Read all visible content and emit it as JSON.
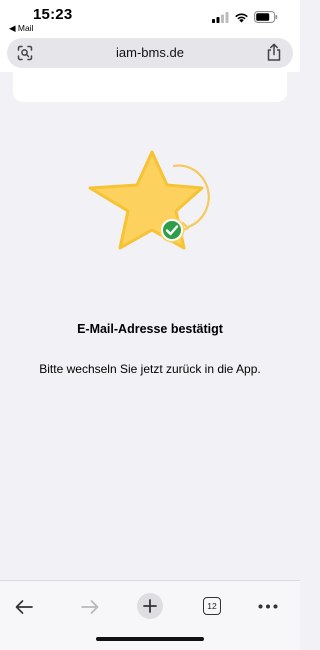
{
  "status_bar": {
    "time": "15:23",
    "back_app": "◀ Mail",
    "icons": [
      "cellular-signal-icon",
      "wifi-icon",
      "battery-icon"
    ]
  },
  "address_bar": {
    "url": "iam-bms.de",
    "left_icon": "page-tools-icon",
    "right_icon": "share-icon"
  },
  "content": {
    "heading": "E-Mail-Adresse bestätigt",
    "message": "Bitte wechseln Sie jetzt zurück in die App.",
    "illustration": "star-check-illustration"
  },
  "toolbar": {
    "tab_count": "12",
    "buttons": [
      "back-icon",
      "forward-icon",
      "plus-icon",
      "tabs-icon",
      "more-icon"
    ]
  },
  "colors": {
    "star_fill": "#fcd15e",
    "star_stroke": "#f6c334",
    "check_badge": "#2f9e4a",
    "page_bg": "#f2f2f6"
  }
}
